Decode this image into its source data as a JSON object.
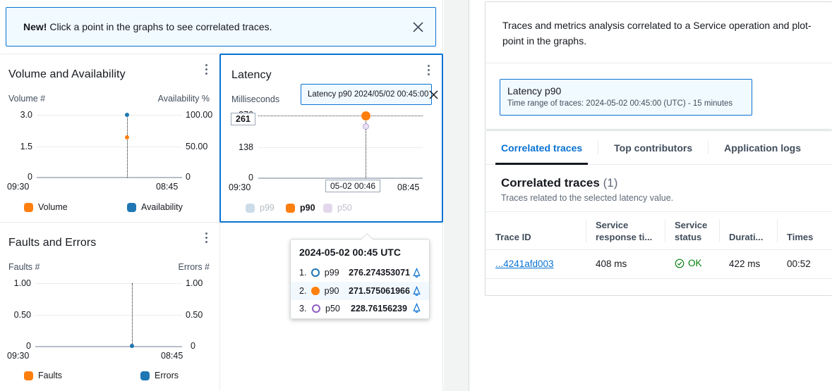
{
  "banner": {
    "badge": "New!",
    "message": "Click a point in the graphs to see correlated traces.",
    "close_label": "✕"
  },
  "charts": {
    "volume": {
      "title": "Volume and Availability",
      "left_axis_title": "Volume #",
      "right_axis_title": "Availability %",
      "left_ticks": [
        "3.0",
        "1.5",
        "0"
      ],
      "right_ticks": [
        "100.00",
        "50.00",
        "0"
      ],
      "x_ticks": [
        "09:30",
        "08:45"
      ],
      "legend": [
        {
          "label": "Volume",
          "color": "#ff7f0e"
        },
        {
          "label": "Availability",
          "color": "#1f77b4"
        }
      ]
    },
    "latency": {
      "title": "Latency",
      "left_axis_title": "Milliseconds",
      "y_ticks": [
        "276",
        "138",
        "0"
      ],
      "x_ticks": [
        "09:30",
        "08:45"
      ],
      "value_callout": "261",
      "time_callout": "05-02 00:46",
      "selection_pill": "Latency p90 2024/05/02 00:45:00",
      "selection_close": "✕",
      "legend": [
        {
          "label": "p99",
          "color": "#ccdce8",
          "active": false
        },
        {
          "label": "p90",
          "color": "#ff7f0e",
          "active": true
        },
        {
          "label": "p50",
          "color": "#e3d7ee",
          "active": false
        }
      ]
    },
    "faults": {
      "title": "Faults and Errors",
      "left_axis_title": "Faults #",
      "right_axis_title": "Errors #",
      "left_ticks": [
        "1.00",
        "0.50",
        "0"
      ],
      "right_ticks": [
        "1.00",
        "0.50",
        "0"
      ],
      "x_ticks": [
        "09:30",
        "08:45"
      ],
      "legend": [
        {
          "label": "Faults",
          "color": "#ff7f0e"
        },
        {
          "label": "Errors",
          "color": "#1f77b4"
        }
      ]
    }
  },
  "tooltip": {
    "title": "2024-05-02 00:45 UTC",
    "rows": [
      {
        "index": "1.",
        "series": "p99",
        "value": "276.274353071",
        "color": "#1f77b4",
        "filled": false,
        "highlight": false
      },
      {
        "index": "2.",
        "series": "p90",
        "value": "271.575061966",
        "color": "#ff7f0e",
        "filled": true,
        "highlight": true
      },
      {
        "index": "3.",
        "series": "p50",
        "value": "228.76156239",
        "color": "#8e5ec2",
        "filled": false,
        "highlight": false
      }
    ],
    "alarm_icon": "bell-icon"
  },
  "right_panel": {
    "description": "Traces and metrics analysis correlated to a Service operation and plot-point in the graphs.",
    "metric_chip": {
      "title": "Latency p90",
      "subtitle": "Time range of traces: 2024-05-02 00:45:00 (UTC) - 15 minutes"
    },
    "tabs": [
      {
        "label": "Correlated traces",
        "active": true
      },
      {
        "label": "Top contributors",
        "active": false
      },
      {
        "label": "Application logs",
        "active": false
      }
    ],
    "section": {
      "title": "Correlated traces",
      "count": "(1)",
      "subtitle": "Traces related to the selected latency value."
    },
    "table": {
      "columns": [
        "Trace ID",
        "Service response ti...",
        "Service status",
        "Durati...",
        "Times"
      ],
      "rows": [
        {
          "trace_id": "...4241afd003",
          "service_response_time": "408 ms",
          "service_status": "OK",
          "duration": "422 ms",
          "timestamp": "00:52"
        }
      ]
    }
  },
  "split_panel": {
    "handle_label": "resize-handle"
  },
  "chart_data": [
    {
      "type": "scatter",
      "title": "Volume and Availability",
      "xlabel": "",
      "ylabel": "Volume #",
      "y2label": "Availability %",
      "x": [
        "2024-05-02 00:45"
      ],
      "series": [
        {
          "name": "Volume",
          "values": [
            2.0
          ],
          "color": "#ff7f0e",
          "axis": "left"
        },
        {
          "name": "Availability",
          "values": [
            100.0
          ],
          "color": "#1f77b4",
          "axis": "right"
        }
      ],
      "ylim": [
        0,
        3.0
      ],
      "y2lim": [
        0,
        100.0
      ],
      "yticks": [
        0,
        1.5,
        3.0
      ],
      "y2ticks": [
        0,
        50.0,
        100.0
      ],
      "xticklabels": [
        "09:30",
        "08:45"
      ],
      "grid": true,
      "legend_position": "bottom"
    },
    {
      "type": "scatter",
      "title": "Latency",
      "xlabel": "",
      "ylabel": "Milliseconds",
      "x": [
        "2024-05-02 00:45"
      ],
      "series": [
        {
          "name": "p99",
          "values": [
            276.274353071
          ],
          "color": "#ccdce8"
        },
        {
          "name": "p90",
          "values": [
            271.575061966
          ],
          "color": "#ff7f0e"
        },
        {
          "name": "p50",
          "values": [
            228.76156239
          ],
          "color": "#e3d7ee"
        }
      ],
      "ylim": [
        0,
        276
      ],
      "yticks": [
        0,
        138,
        276
      ],
      "xticklabels": [
        "09:30",
        "08:45"
      ],
      "annotations": [
        "261",
        "05-02 00:46"
      ],
      "grid": true,
      "legend_position": "bottom"
    },
    {
      "type": "scatter",
      "title": "Faults and Errors",
      "xlabel": "",
      "ylabel": "Faults #",
      "y2label": "Errors #",
      "x": [
        "2024-05-02 00:45"
      ],
      "series": [
        {
          "name": "Faults",
          "values": [
            0
          ],
          "color": "#ff7f0e",
          "axis": "left"
        },
        {
          "name": "Errors",
          "values": [
            0
          ],
          "color": "#1f77b4",
          "axis": "right"
        }
      ],
      "ylim": [
        0,
        1.0
      ],
      "y2lim": [
        0,
        1.0
      ],
      "yticks": [
        0,
        0.5,
        1.0
      ],
      "y2ticks": [
        0,
        0.5,
        1.0
      ],
      "xticklabels": [
        "09:30",
        "08:45"
      ],
      "grid": true,
      "legend_position": "bottom"
    }
  ]
}
